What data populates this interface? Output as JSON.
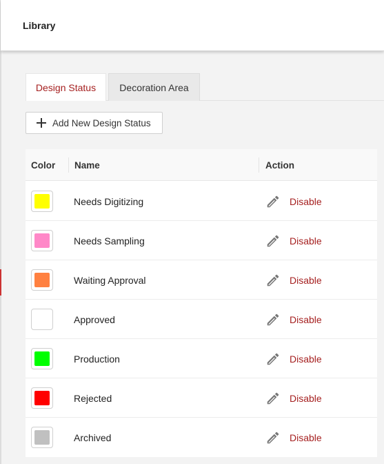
{
  "header": {
    "title": "Library"
  },
  "tabs": [
    {
      "label": "Design Status",
      "active": true
    },
    {
      "label": "Decoration Area",
      "active": false
    }
  ],
  "toolbar": {
    "add_label": "Add New Design Status"
  },
  "table": {
    "columns": {
      "color": "Color",
      "name": "Name",
      "action": "Action"
    },
    "action_label": "Disable",
    "rows": [
      {
        "name": "Needs Digitizing",
        "color": "#ffff00"
      },
      {
        "name": "Needs Sampling",
        "color": "#ff88c8"
      },
      {
        "name": "Waiting Approval",
        "color": "#ff8040"
      },
      {
        "name": "Approved",
        "color": "#ffffff"
      },
      {
        "name": "Production",
        "color": "#00ff00"
      },
      {
        "name": "Rejected",
        "color": "#ff0000"
      },
      {
        "name": "Archived",
        "color": "#c0c0c0"
      }
    ]
  },
  "colors": {
    "accent": "#a51f1f",
    "edit_icon": "#777777"
  }
}
